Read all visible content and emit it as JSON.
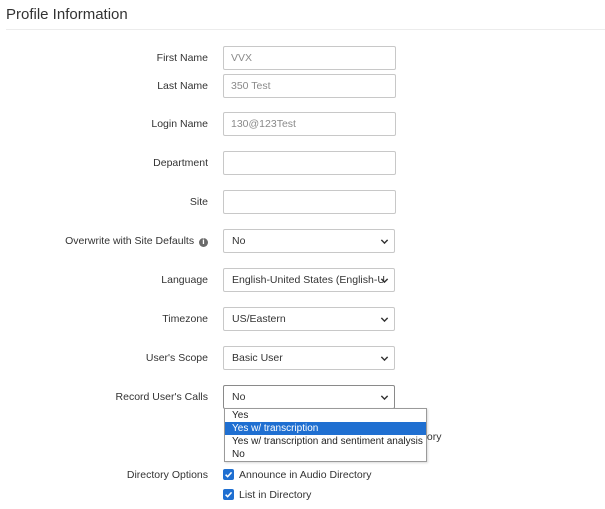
{
  "section": {
    "title": "Profile Information"
  },
  "fields": {
    "first_name": {
      "label": "First Name",
      "value": "VVX"
    },
    "last_name": {
      "label": "Last Name",
      "value": "350 Test"
    },
    "login_name": {
      "label": "Login Name",
      "value": "130@123Test"
    },
    "department": {
      "label": "Department",
      "value": ""
    },
    "site": {
      "label": "Site",
      "value": ""
    },
    "overwrite_defaults": {
      "label": "Overwrite with Site Defaults",
      "icon": "info-icon",
      "value": "No"
    },
    "language": {
      "label": "Language",
      "value": "English-United States (English-U"
    },
    "timezone": {
      "label": "Timezone",
      "value": "US/Eastern"
    },
    "scope": {
      "label": "User's Scope",
      "value": "Basic User"
    },
    "record_calls": {
      "label": "Record User's Calls",
      "value": "No",
      "options": [
        "Yes",
        "Yes w/ transcription",
        "Yes w/ transcription and sentiment analysis",
        "No"
      ],
      "highlighted_option": "Yes w/ transcription"
    },
    "obscured_option_text": "tory",
    "directory_options": {
      "label": "Directory Options",
      "announce": {
        "label": "Announce in Audio Directory",
        "checked": true
      },
      "list": {
        "label": "List in Directory",
        "checked": true
      }
    }
  },
  "colors": {
    "accent": "#1f6fd1",
    "border": "#c8c8c8"
  }
}
